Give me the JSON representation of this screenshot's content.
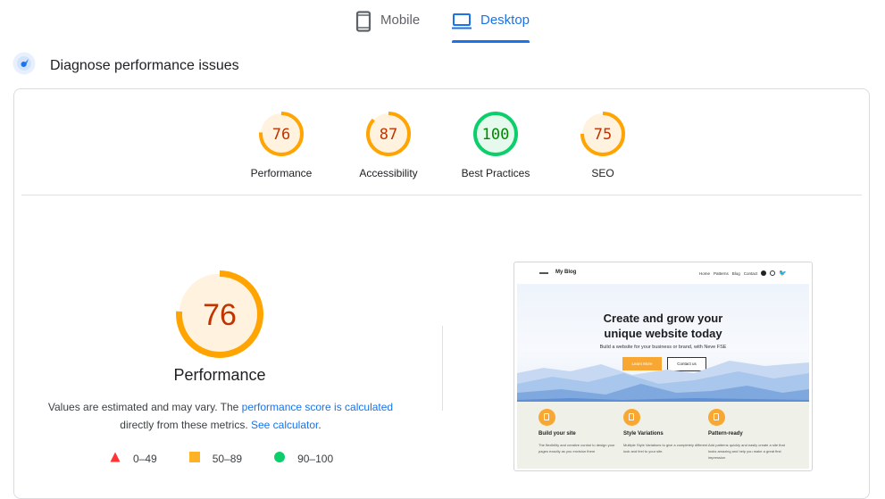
{
  "tabs": [
    {
      "label": "Mobile",
      "icon": "smartphone-icon",
      "selected": false
    },
    {
      "label": "Desktop",
      "icon": "laptop-icon",
      "selected": true
    }
  ],
  "section": {
    "title": "Diagnose performance issues",
    "icon": "gauge-icon"
  },
  "colors": {
    "average": "#ffa400",
    "average_text": "#c33300",
    "average_bg": "#fff3e0",
    "pass": "#0cce6b",
    "pass_text": "#008800",
    "pass_bg": "#e5f9ec",
    "fail": "#ff3333",
    "link": "#1a73e8"
  },
  "scores": [
    {
      "label": "Performance",
      "value": 76,
      "rating": "average"
    },
    {
      "label": "Accessibility",
      "value": 87,
      "rating": "average"
    },
    {
      "label": "Best Practices",
      "value": 100,
      "rating": "pass"
    },
    {
      "label": "SEO",
      "value": 75,
      "rating": "average"
    }
  ],
  "main": {
    "score": 76,
    "label": "Performance",
    "desc_pre": "Values are estimated and may vary. The ",
    "desc_link1": "performance score is calculated",
    "desc_mid": " directly from these metrics. ",
    "desc_link2": "See calculator",
    "desc_post": "."
  },
  "legend": [
    {
      "shape": "triangle",
      "range": "0–49"
    },
    {
      "shape": "square",
      "range": "50–89"
    },
    {
      "shape": "circle",
      "range": "90–100"
    }
  ],
  "screenshot": {
    "brand": "My Blog",
    "nav_links": [
      "Home",
      "Patterns",
      "Blog",
      "Contact"
    ],
    "social_icons": [
      "facebook-icon",
      "instagram-icon",
      "twitter-icon"
    ],
    "headline_1": "Create and grow your",
    "headline_2": "unique website today",
    "subtitle": "Build a website for your business or brand, with Neve FSE",
    "primary_button": "Learn More",
    "secondary_button": "Contact us",
    "features": [
      {
        "title": "Build your site",
        "text": "The flexibility and creative control to design your pages exactly as you envision them"
      },
      {
        "title": "Style Variations",
        "text": "Multiple Style Variations to give a completely different look and feel to your site."
      },
      {
        "title": "Pattern-ready",
        "text": "Add patterns quickly and easily create a site that looks amazing and help you make a great first impression"
      }
    ]
  }
}
